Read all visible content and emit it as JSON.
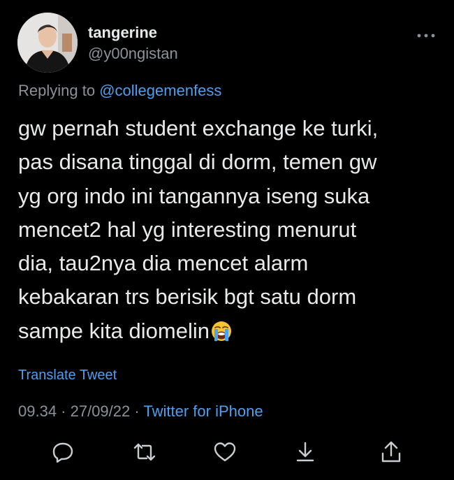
{
  "tweet": {
    "author": {
      "name": "tangerine",
      "handle": "@y00ngistan",
      "avatar_icon": "profile-photo"
    },
    "replying_to": {
      "prefix": "Replying to",
      "mention": "@collegemenfess"
    },
    "text_lines": [
      "gw pernah student exchange ke turki,",
      "pas disana tinggal di dorm, temen gw",
      "yg org indo ini tangannya iseng suka",
      "mencet2 hal yg interesting menurut",
      "dia, tau2nya dia mencet alarm",
      "kebakaran trs berisik bgt satu dorm",
      "sampe kita diomelin"
    ],
    "text_emoji": "loudly-crying-face",
    "translate_label": "Translate Tweet",
    "timestamp": "09.34 · 27/09/22 ·",
    "source": "Twitter for iPhone"
  },
  "actions": [
    {
      "icon": "reply-icon"
    },
    {
      "icon": "retweet-icon"
    },
    {
      "icon": "like-icon"
    },
    {
      "icon": "bookmark-icon"
    },
    {
      "icon": "share-icon"
    }
  ],
  "colors": {
    "background": "#000000",
    "text": "#e7e9ea",
    "muted": "#8b9298",
    "link": "#4d9ff0"
  }
}
